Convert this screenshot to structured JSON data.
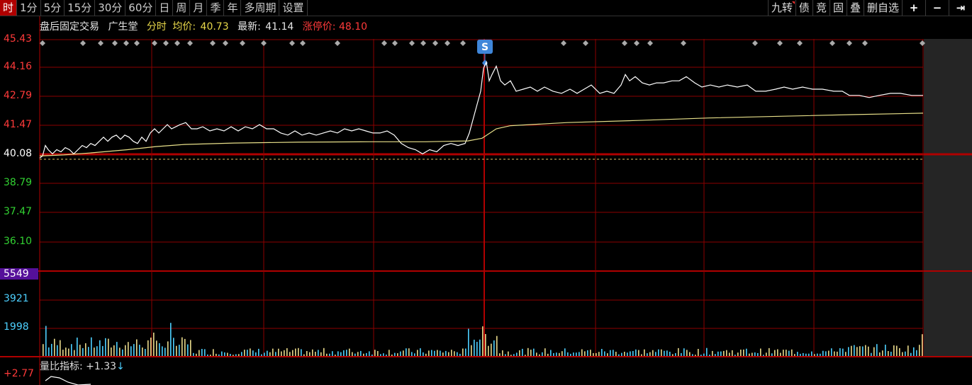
{
  "toolbar": {
    "left_items": [
      "时",
      "1分",
      "5分",
      "15分",
      "30分",
      "60分",
      "日",
      "周",
      "月",
      "季",
      "年",
      "多周期",
      "设置"
    ],
    "active_index": 0,
    "right_items": [
      "九转",
      "债",
      "竞",
      "固",
      "叠",
      "删自选"
    ],
    "right_icons": [
      "+",
      "−",
      "⇥"
    ]
  },
  "info": {
    "session": "盘后固定交易",
    "stock_name": "广生堂",
    "mode": "分时",
    "avg_label": "均价:",
    "avg_value": "40.73",
    "latest_label": "最新:",
    "latest_value": "41.14",
    "limit_label": "涨停价:",
    "limit_value": "48.10"
  },
  "price_axis": {
    "labels": [
      "45.43",
      "44.16",
      "42.79",
      "41.47",
      "40.08",
      "38.79",
      "37.47",
      "36.10"
    ],
    "prev_close": "40.08"
  },
  "volume_axis": {
    "labels": [
      "5549",
      "3921",
      "1998"
    ]
  },
  "ratio": {
    "label": "量比指标:",
    "value": "+1.33",
    "arrow": "↓",
    "axis_top": "+2.77"
  },
  "marker": {
    "letter": "S"
  },
  "colors": {
    "grid": "#8b0000",
    "price_line": "#ffffff",
    "avg_line": "#e8e08a",
    "axis_up": "#ff3a3a",
    "axis_down": "#32d232",
    "axis_vol": "#4dd0ff",
    "marker_blue": "#3f86d9"
  }
}
